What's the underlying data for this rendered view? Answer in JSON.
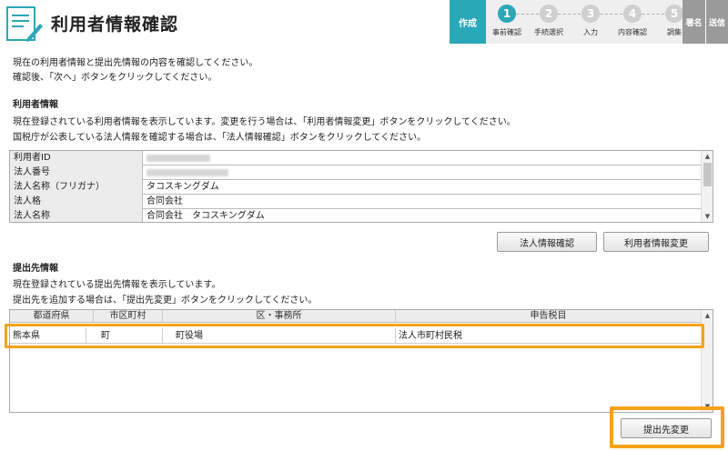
{
  "header": {
    "title": "利用者情報確認"
  },
  "steps": {
    "sakusei": "作成",
    "items": [
      {
        "num": "1",
        "label": "事前確認"
      },
      {
        "num": "2",
        "label": "手続選択"
      },
      {
        "num": "3",
        "label": "入力"
      },
      {
        "num": "4",
        "label": "内容確認"
      },
      {
        "num": "5",
        "label": "調集"
      }
    ],
    "shomei": "署名",
    "soshin": "送信"
  },
  "intro": {
    "line1": "現在の利用者情報と提出先情報の内容を確認してください。",
    "line2": "確認後、「次へ」ボタンをクリックしてください。"
  },
  "user_section": {
    "title": "利用者情報",
    "desc1": "現在登録されている利用者情報を表示しています。変更を行う場合は、「利用者情報変更」ボタンをクリックしてください。",
    "desc2": "国税庁が公表している法人情報を確認する場合は、「法人情報確認」ボタンをクリックしてください。",
    "rows": [
      {
        "label": "利用者ID",
        "value": ""
      },
      {
        "label": "法人番号",
        "value": ""
      },
      {
        "label": "法人名称（フリガナ）",
        "value": "タコスキングダム"
      },
      {
        "label": "法人格",
        "value": "合同会社"
      },
      {
        "label": "法人名称",
        "value": "合同会社　タコスキングダム"
      }
    ],
    "btn_corp_info": "法人情報確認",
    "btn_user_change": "利用者情報変更"
  },
  "submit_section": {
    "title": "提出先情報",
    "desc1": "現在登録されている提出先情報を表示しています。",
    "desc2": "提出先を追加する場合は、「提出先変更」ボタンをクリックしてください。",
    "columns": [
      "都道府県",
      "市区町村",
      "区・事務所",
      "申告税目"
    ],
    "row": {
      "pref": "熊本県",
      "city": "町",
      "office": "町役場",
      "tax": "法人市町村民税"
    },
    "btn_change": "提出先変更"
  }
}
